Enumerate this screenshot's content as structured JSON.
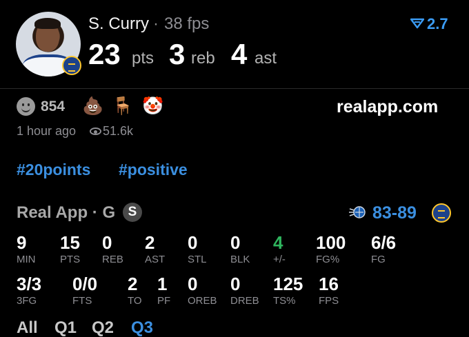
{
  "player": {
    "name": "S. Curry",
    "separator": "·",
    "fps_label": "38 fps",
    "points": "23",
    "points_label": "pts",
    "rebounds": "3",
    "rebounds_label": "reb",
    "assists": "4",
    "assists_label": "ast",
    "rank_value": "2.7"
  },
  "reactions": {
    "count": "854",
    "emojis": [
      "💩",
      "🪑",
      "🤡"
    ]
  },
  "site": "realapp.com",
  "meta": {
    "time_ago": "1 hour ago",
    "views": "51.6k"
  },
  "tags": [
    "#20points",
    "#positive"
  ],
  "game": {
    "source": "Real App · G",
    "position_badge": "S",
    "score": "83-89"
  },
  "stats_row1": [
    {
      "value": "9",
      "label": "MIN"
    },
    {
      "value": "15",
      "label": "PTS"
    },
    {
      "value": "0",
      "label": "REB"
    },
    {
      "value": "2",
      "label": "AST"
    },
    {
      "value": "0",
      "label": "STL"
    },
    {
      "value": "0",
      "label": "BLK"
    },
    {
      "value": "4",
      "label": "+/-"
    },
    {
      "value": "100",
      "label": "FG%"
    },
    {
      "value": "6/6",
      "label": "FG"
    }
  ],
  "stats_row2": [
    {
      "value": "3/3",
      "label": "3FG"
    },
    {
      "value": "0/0",
      "label": "FTS"
    },
    {
      "value": "2",
      "label": "TO"
    },
    {
      "value": "1",
      "label": "PF"
    },
    {
      "value": "0",
      "label": "OREB"
    },
    {
      "value": "0",
      "label": "DREB"
    },
    {
      "value": "125",
      "label": "TS%"
    },
    {
      "value": "16",
      "label": "FPS"
    }
  ],
  "quarters": [
    "All",
    "Q1",
    "Q2",
    "Q3"
  ],
  "active_quarter": "Q3",
  "colors": {
    "background": "#000000",
    "accent_blue": "#3b8fe0",
    "positive_green": "#2fb55e",
    "muted_gray": "#8e8e93"
  }
}
